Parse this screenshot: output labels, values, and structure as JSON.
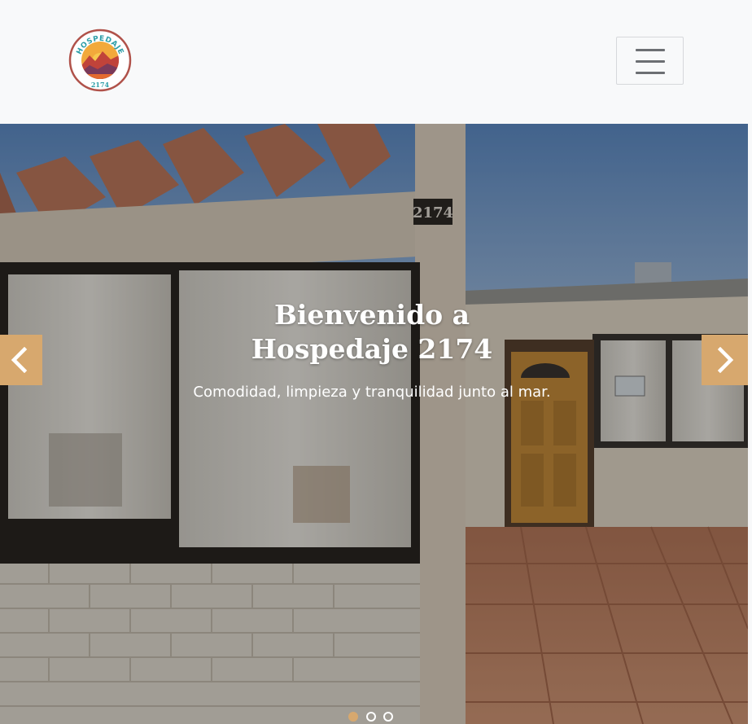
{
  "navbar": {
    "logo": {
      "top_text": "HOSPEDAJE",
      "bottom_text": "2174",
      "icon": "mountain-sunset-logo"
    },
    "toggler_icon": "hamburger-menu-icon",
    "colors": {
      "background": "#f8f9fa",
      "logo_ring": "#b0524a",
      "logo_sun": "#f2a93b"
    }
  },
  "carousel": {
    "slide": {
      "title_line1": "Bienvenido a",
      "title_line2": "Hospedaje 2174",
      "subtitle": "Comodidad, limpieza y tranquilidad junto al mar.",
      "house_number": "2174"
    },
    "controls": {
      "prev_icon": "chevron-left-icon",
      "next_icon": "chevron-right-icon",
      "color": "#d7a86e"
    },
    "indicators": {
      "count": 3,
      "active_index": 0
    }
  }
}
